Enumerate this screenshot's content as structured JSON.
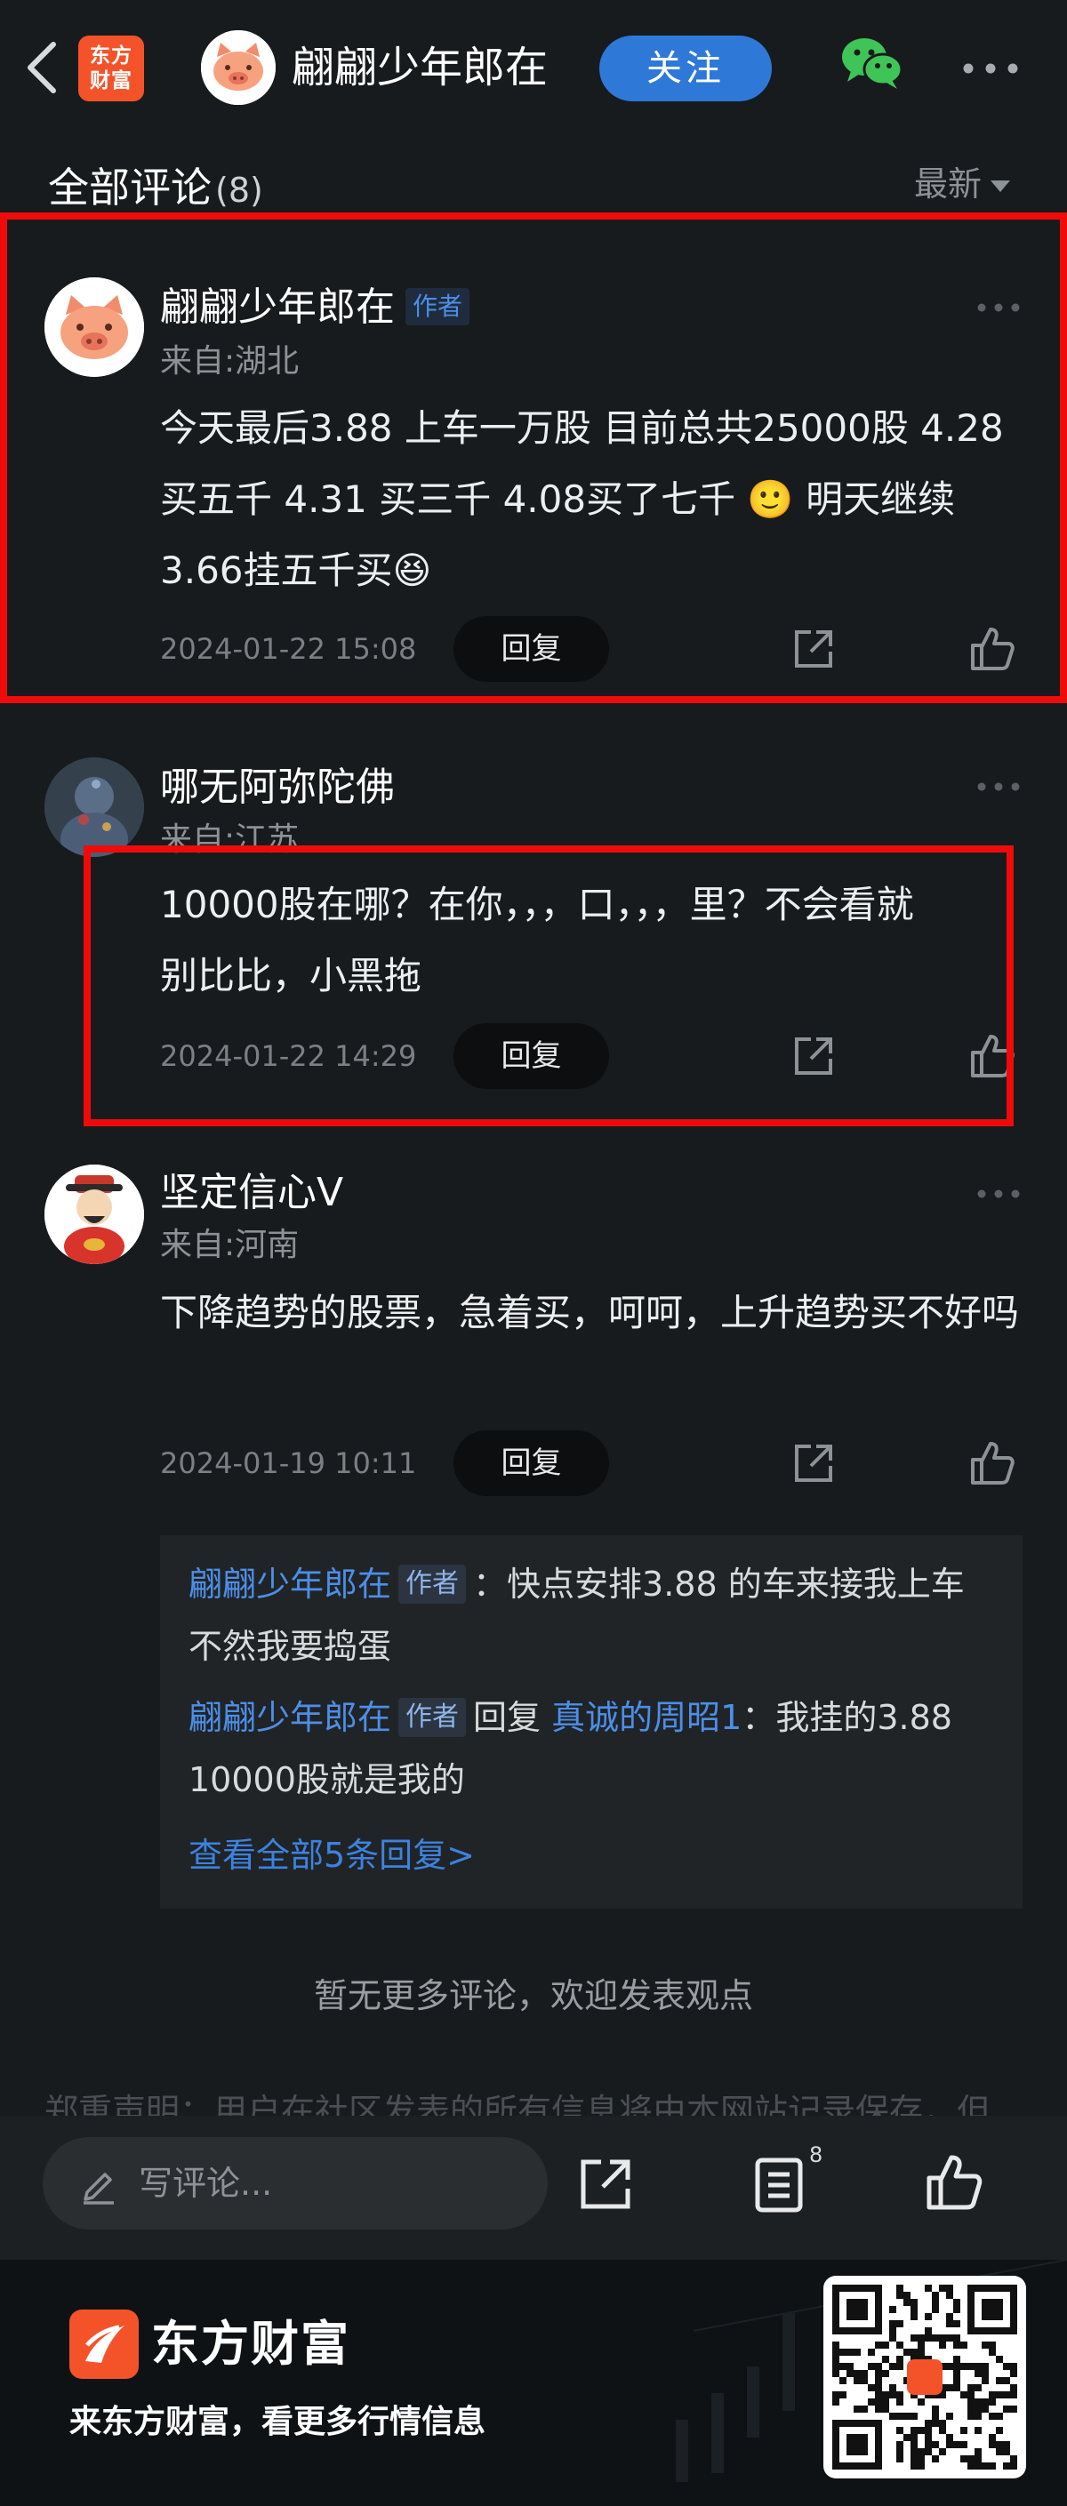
{
  "header": {
    "brand_logo_text_1": "东方",
    "brand_logo_text_2": "财富",
    "author_name": "翩翩少年郎在",
    "follow_label": "关注"
  },
  "list": {
    "title": "全部评论",
    "count": "(8)",
    "sort_label": "最新"
  },
  "comments": [
    {
      "username": "翩翩少年郎在",
      "tag": "作者",
      "location": "来自:湖北",
      "text": "今天最后3.88 上车一万股 目前总共25000股 4.28 买五千 4.31 买三千  4.08买了七千 🙂 明天继续3.66挂五千买😆",
      "time": "2024-01-22 15:08",
      "reply_label": "回复"
    },
    {
      "username": "哪无阿弥陀佛",
      "location": "来自:江苏",
      "text": "10000股在哪？在你，，，口，，，里？不会看就别比比，小黑拖",
      "time": "2024-01-22 14:29",
      "reply_label": "回复"
    },
    {
      "username": "坚定信心V",
      "location": "来自:河南",
      "text": "下降趋势的股票，急着买，呵呵，上升趋势买不好吗",
      "time": "2024-01-19 10:11",
      "reply_label": "回复",
      "replies": [
        {
          "user": "翩翩少年郎在",
          "tag": "作者",
          "text": "：快点安排3.88 的车来接我上车 不然我要捣蛋"
        },
        {
          "user": "翩翩少年郎在",
          "tag": "作者",
          "reply_word": "回复",
          "target": "真诚的周昭1",
          "text": "：我挂的3.88 10000股就是我的"
        }
      ],
      "view_all": "查看全部5条回复>"
    }
  ],
  "no_more": "暂无更多评论，欢迎发表观点",
  "disclaimer": "郑重声明：用户在社区发表的所有信息将由本网站记录保存，但",
  "bottom_bar": {
    "input_placeholder": "写评论...",
    "comment_count": "8"
  },
  "footer": {
    "brand": "东方财富",
    "slogan": "来东方财富，看更多行情信息"
  },
  "colors": {
    "background": "#171b1d",
    "accent_blue": "#2e79d8",
    "brand_orange": "#f4532a",
    "highlight_red": "#f00b0b"
  }
}
